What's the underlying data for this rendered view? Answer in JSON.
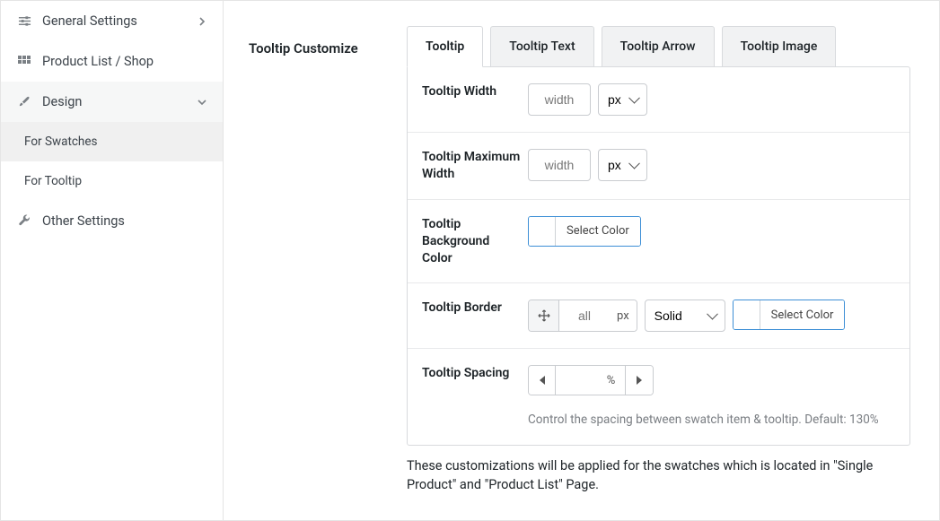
{
  "sidebar": {
    "items": [
      {
        "label": "General Settings",
        "icon": "sliders"
      },
      {
        "label": "Product List / Shop",
        "icon": "grid"
      },
      {
        "label": "Design",
        "icon": "brush"
      },
      {
        "label": "Other Settings",
        "icon": "wrench"
      }
    ],
    "subitems": [
      {
        "label": "For Swatches"
      },
      {
        "label": "For Tooltip"
      }
    ]
  },
  "section_title": "Tooltip Customize",
  "tabs": [
    {
      "label": "Tooltip"
    },
    {
      "label": "Tooltip Text"
    },
    {
      "label": "Tooltip Arrow"
    },
    {
      "label": "Tooltip Image"
    }
  ],
  "fields": {
    "width": {
      "label": "Tooltip Width",
      "placeholder": "width",
      "unit": "px"
    },
    "maxwidth": {
      "label": "Tooltip Maximum Width",
      "placeholder": "width",
      "unit": "px"
    },
    "bgcolor": {
      "label": "Tooltip Background Color",
      "btn": "Select Color"
    },
    "border": {
      "label": "Tooltip Border",
      "side": "all",
      "unit": "px",
      "style": "Solid",
      "colorbtn": "Select Color"
    },
    "spacing": {
      "label": "Tooltip Spacing",
      "unit": "%",
      "help": "Control the spacing between swatch item & tooltip. Default: 130%"
    }
  },
  "footnote": "These customizations will be applied for the swatches which is located in \"Single Product\" and \"Product List\" Page."
}
